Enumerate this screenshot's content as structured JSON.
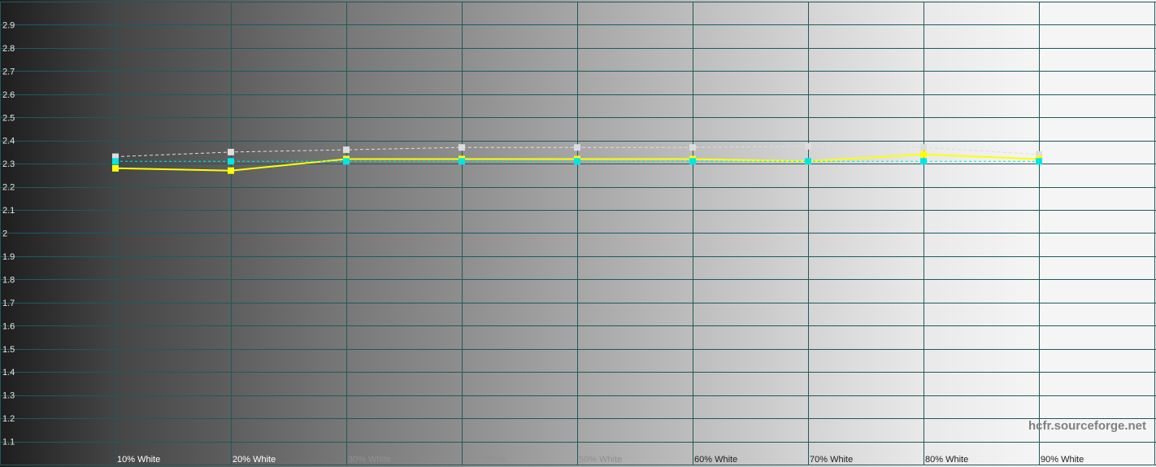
{
  "watermark": "hcfr.sourceforge.net",
  "colors": {
    "grid": "#1f5a5a",
    "actual": "#ffff00",
    "reference": "#00e5e5",
    "secondary": "#dddddd",
    "bands": [
      "#303030",
      "#454545",
      "#5e5e5e",
      "#787878",
      "#8e8e8e",
      "#a6a6a6",
      "#bdbdbd",
      "#d4d4d4",
      "#e9e9e9",
      "#f5f5f5"
    ]
  },
  "chart_data": {
    "type": "line",
    "title": "",
    "xlabel": "",
    "ylabel": "",
    "categories": [
      "10% White",
      "20% White",
      "30% White",
      "40% White",
      "50% White",
      "60% White",
      "70% White",
      "80% White",
      "90% White"
    ],
    "ylim": [
      1.0,
      3.0
    ],
    "yticks": [
      "1.1",
      "1.2",
      "1.3",
      "1.4",
      "1.5",
      "1.6",
      "1.7",
      "1.8",
      "1.9",
      "2",
      "2.1",
      "2.2",
      "2.3",
      "2.4",
      "2.5",
      "2.6",
      "2.7",
      "2.8",
      "2.9"
    ],
    "grid": true,
    "series": [
      {
        "key": "actual",
        "values": [
          2.28,
          2.27,
          2.32,
          2.32,
          2.32,
          2.32,
          2.31,
          2.34,
          2.32
        ]
      },
      {
        "key": "reference",
        "values": [
          2.31,
          2.31,
          2.31,
          2.31,
          2.31,
          2.31,
          2.31,
          2.31,
          2.31
        ]
      },
      {
        "key": "secondary",
        "values": [
          2.33,
          2.35,
          2.36,
          2.37,
          2.37,
          2.37,
          2.375,
          2.37,
          2.34
        ]
      }
    ]
  }
}
